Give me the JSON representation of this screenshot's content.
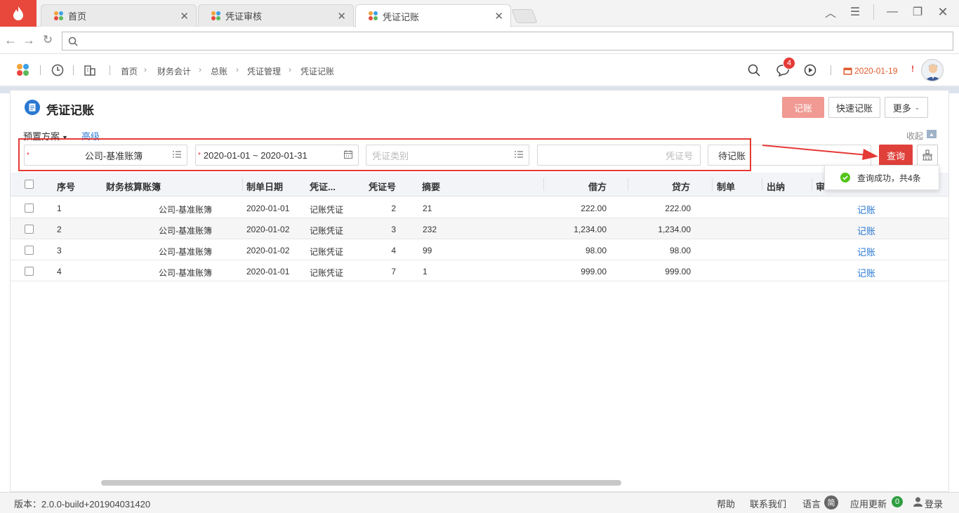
{
  "tabs": [
    {
      "label": "首页",
      "active": false
    },
    {
      "label": "凭证审核",
      "active": false
    },
    {
      "label": "凭证记账",
      "active": true
    }
  ],
  "header": {
    "breadcrumb": [
      "首页",
      "财务会计",
      "总账",
      "凭证管理",
      "凭证记账"
    ],
    "notification_count": "4",
    "date": "2020-01-19"
  },
  "page": {
    "title": "凭证记账",
    "buttons": {
      "post": "记账",
      "quick_post": "快速记账",
      "more": "更多"
    },
    "preset": "预置方案",
    "advanced": "高级",
    "collapse": "收起"
  },
  "filters": {
    "ledger": "公司-基准账簿",
    "date_range": "2020-01-01 ~ 2020-01-31",
    "voucher_type_placeholder": "凭证类别",
    "voucher_no_placeholder": "凭证号",
    "status": "待记账",
    "query": "查询"
  },
  "toast": "查询成功，共4条",
  "table": {
    "headers": {
      "seq": "序号",
      "ledger": "财务核算账簿",
      "date": "制单日期",
      "voucher": "凭证...",
      "no": "凭证号",
      "summary": "摘要",
      "debit": "借方",
      "credit": "贷方",
      "maker": "制单",
      "cashier": "出纳",
      "auditor": "审"
    },
    "rows": [
      {
        "seq": "1",
        "ledger": "公司-基准账簿",
        "date": "2020-01-01",
        "voucher": "记账凭证",
        "no": "2",
        "summary": "21",
        "debit": "222.00",
        "credit": "222.00",
        "action": "记账"
      },
      {
        "seq": "2",
        "ledger": "公司-基准账簿",
        "date": "2020-01-02",
        "voucher": "记账凭证",
        "no": "3",
        "summary": "232",
        "debit": "1,234.00",
        "credit": "1,234.00",
        "action": "记账"
      },
      {
        "seq": "3",
        "ledger": "公司-基准账簿",
        "date": "2020-01-02",
        "voucher": "记账凭证",
        "no": "4",
        "summary": "99",
        "debit": "98.00",
        "credit": "98.00",
        "action": "记账"
      },
      {
        "seq": "4",
        "ledger": "公司-基准账簿",
        "date": "2020-01-01",
        "voucher": "记账凭证",
        "no": "7",
        "summary": "1",
        "debit": "999.00",
        "credit": "999.00",
        "action": "记账"
      }
    ]
  },
  "footer": {
    "version": "版本：2.0.0-build+201904031420",
    "help": "帮助",
    "contact": "联系我们",
    "language": "语言",
    "language_badge": "简",
    "updates": "应用更新",
    "updates_count": "0",
    "login": "登录"
  },
  "colors": {
    "brand": "#e8473c",
    "primary": "#e0403a",
    "link": "#2a78d1",
    "annotation": "#e53935",
    "success": "#52c41a"
  }
}
